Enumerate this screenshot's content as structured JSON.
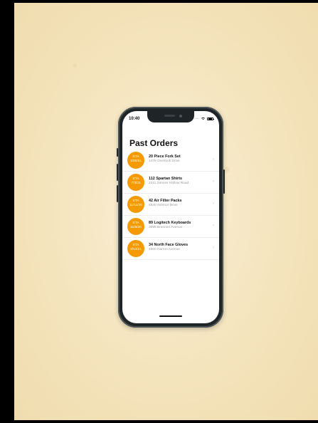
{
  "status_bar": {
    "time": "10:40",
    "signal_dots": "∙∙∙∙",
    "wifi_icon": "wifi-icon",
    "battery_icon": "battery-icon"
  },
  "screen": {
    "title": "Past Orders"
  },
  "orders": [
    {
      "eta_label": "ETA",
      "eta_date": "1/20/21",
      "item": "20 Piece Fork Set",
      "address": "1478 Overlook Drive"
    },
    {
      "eta_label": "ETA",
      "eta_date": "7/3/21",
      "item": "112 Spartan Shirts",
      "address": "2311 Simons Hollow Road"
    },
    {
      "eta_label": "ETA",
      "eta_date": "11/11/20",
      "item": "42 Air Filter Packs",
      "address": "4540 Ashmor Drive"
    },
    {
      "eta_label": "ETA",
      "eta_date": "11/6/20",
      "item": "89 Logitech Keyboards",
      "address": "3898 Brannon Avenue"
    },
    {
      "eta_label": "ETA",
      "eta_date": "3/14/21",
      "item": "34 North Face Gloves",
      "address": "4800 Harron Avenue"
    }
  ],
  "colors": {
    "background": "#f5e4be",
    "phone_frame": "#1f2427",
    "eta_badge": "#f59a00",
    "text": "#111111",
    "secondary_text": "#9a9a9a"
  }
}
